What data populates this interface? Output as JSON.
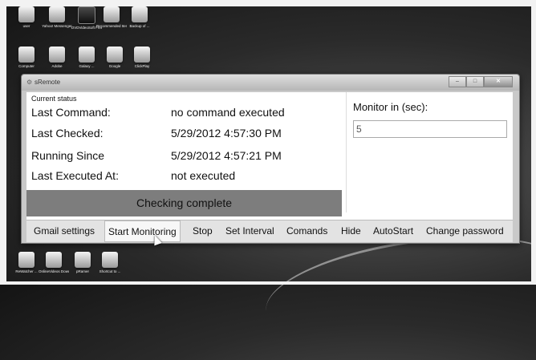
{
  "desktop": {
    "icons_top": [
      {
        "label": "user",
        "icon": "user-folder-icon"
      },
      {
        "label": "Yahoo! Messenger",
        "icon": "messenger-icon"
      },
      {
        "label": "DVDVideoSoft Free Studio",
        "icon": "dvdvideosoft-icon"
      },
      {
        "label": "Recommended Items",
        "icon": "document-icon"
      },
      {
        "label": "Backup of ...",
        "icon": "folder-backup-icon"
      }
    ],
    "icons_mid": [
      {
        "label": "Computer",
        "icon": "computer-icon"
      },
      {
        "label": "Adobe",
        "icon": "pdf-icon"
      },
      {
        "label": "Galaxy ...",
        "icon": "headphones-icon"
      },
      {
        "label": "Google",
        "icon": "chrome-icon"
      },
      {
        "label": "ClickPlay",
        "icon": "arrow-app-icon"
      }
    ],
    "icons_bottom": [
      {
        "label": "ReWatcher ...",
        "icon": "recorder-icon"
      },
      {
        "label": "OnlineVideos Downloader",
        "icon": "downloader-icon"
      },
      {
        "label": "pRamer",
        "icon": "pramer-icon"
      },
      {
        "label": "Shortcut to ...",
        "icon": "shortcut-icon"
      }
    ]
  },
  "window": {
    "title": "sRemote",
    "status": {
      "heading": "Current status",
      "rows": [
        {
          "label": "Last Command:",
          "value": "no command executed"
        },
        {
          "label": "Last Checked:",
          "value": "5/29/2012 4:57:30 PM"
        },
        {
          "label": "Running Since",
          "value": "5/29/2012 4:57:21 PM"
        },
        {
          "label": "Last Executed At:",
          "value": "not executed"
        }
      ]
    },
    "progress": {
      "text": "Checking complete",
      "fraction": 1.0
    },
    "monitor": {
      "label": "Monitor in (sec):",
      "value": "5"
    },
    "menu": [
      "Gmail settings",
      "Start Monitoring",
      "Stop",
      "Set Interval",
      "Comands",
      "Hide",
      "AutoStart",
      "Change password"
    ]
  },
  "colors": {
    "accent": "#8a8a8a",
    "background": "#2a2a2a"
  }
}
